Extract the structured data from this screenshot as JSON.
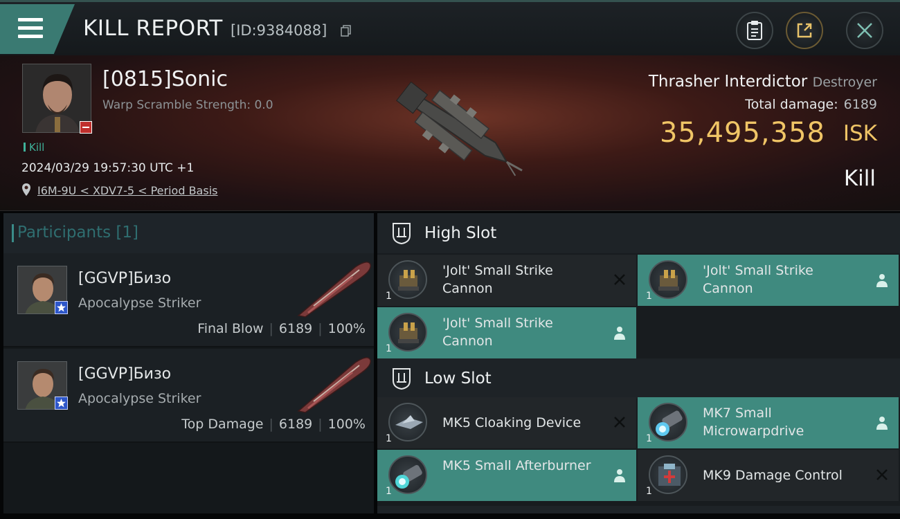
{
  "header": {
    "title": "KILL REPORT",
    "report_id": "[ID:9384088]"
  },
  "victim": {
    "name": "[0815]Sonic",
    "warp_scramble": "Warp Scramble Strength: 0.0",
    "kill_tag": "Kill",
    "timestamp": "2024/03/29 19:57:30 UTC +1",
    "location": "I6M-9U < XDV7-5 < Period Basis",
    "ship_name": "Thrasher Interdictor",
    "ship_class": "Destroyer",
    "total_damage_label": "Total damage:",
    "total_damage": "6189",
    "isk_value": "35,495,358",
    "isk_unit": "ISK",
    "result": "Kill"
  },
  "participants": {
    "label": "Participants",
    "count": "[1]",
    "rows": [
      {
        "name": "[GGVP]Бизо",
        "ship": "Apocalypse Striker",
        "role": "Final Blow",
        "damage": "6189",
        "percent": "100%"
      },
      {
        "name": "[GGVP]Бизо",
        "ship": "Apocalypse Striker",
        "role": "Top Damage",
        "damage": "6189",
        "percent": "100%"
      }
    ]
  },
  "fittings": {
    "high_slot": {
      "label": "High Slot",
      "modules": [
        {
          "name": "'Jolt' Small Strike Cannon",
          "qty": "1",
          "status": "destroyed"
        },
        {
          "name": "'Jolt' Small Strike Cannon",
          "qty": "1",
          "status": "dropped"
        },
        {
          "name": "'Jolt' Small Strike Cannon",
          "qty": "1",
          "status": "dropped"
        }
      ]
    },
    "low_slot": {
      "label": "Low Slot",
      "modules": [
        {
          "name": "MK5 Cloaking Device",
          "qty": "1",
          "status": "destroyed"
        },
        {
          "name": "MK7 Small Microwarpdrive",
          "qty": "1",
          "status": "dropped"
        },
        {
          "name": "MK5 Small Afterburner",
          "qty": "1",
          "status": "dropped"
        },
        {
          "name": "MK9 Damage Control",
          "qty": "1",
          "status": "destroyed"
        }
      ]
    }
  },
  "colors": {
    "accent_teal": "#3f8a7f",
    "isk_gold": "#f0c566",
    "kill_green": "#3fb29a"
  }
}
